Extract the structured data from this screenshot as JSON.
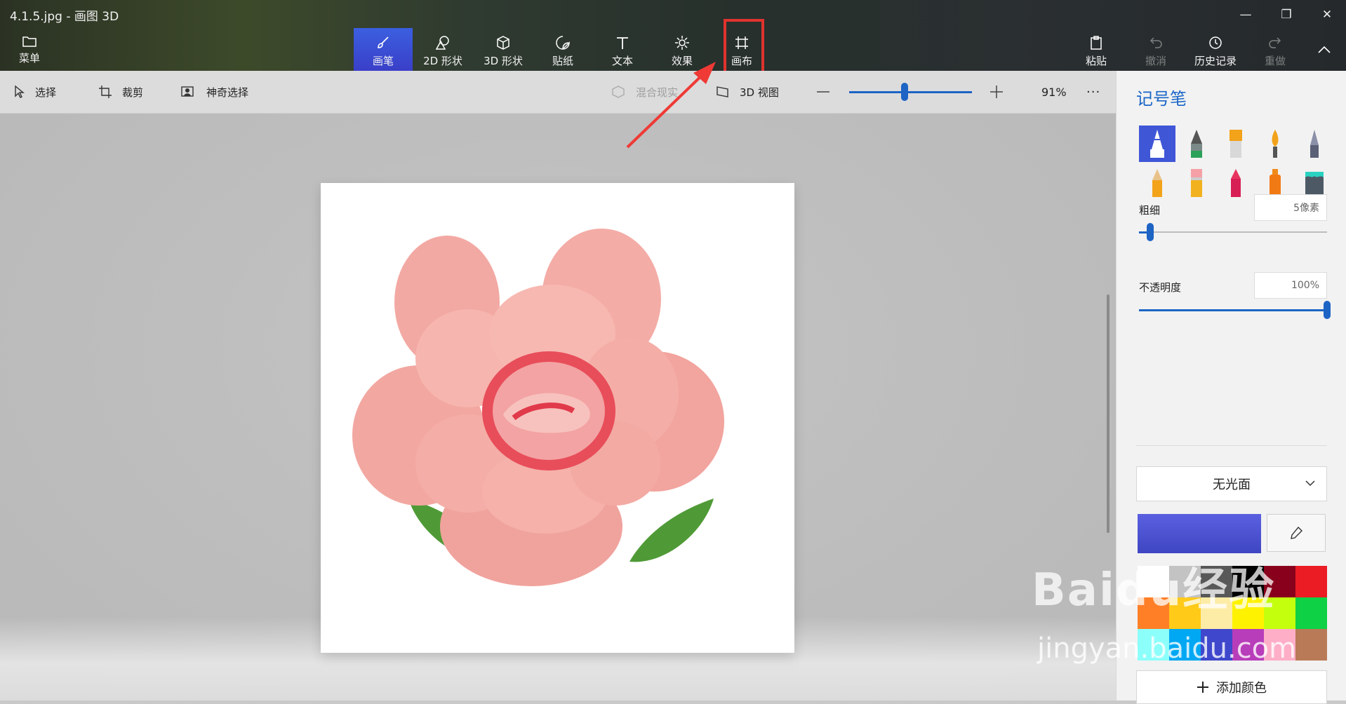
{
  "window": {
    "title": "4.1.5.jpg - 画图 3D",
    "minimize": "—",
    "restore": "❐",
    "close": "✕"
  },
  "toolbar": {
    "menu": "菜单",
    "tools": [
      {
        "label": "画笔",
        "icon": "brush-icon"
      },
      {
        "label": "2D 形状",
        "icon": "2d-shapes-icon"
      },
      {
        "label": "3D 形状",
        "icon": "3d-shapes-icon"
      },
      {
        "label": "贴纸",
        "icon": "sticker-icon"
      },
      {
        "label": "文本",
        "icon": "text-icon"
      },
      {
        "label": "效果",
        "icon": "effects-icon"
      },
      {
        "label": "画布",
        "icon": "canvas-icon"
      }
    ],
    "paste": "粘贴",
    "undo": "撤消",
    "history": "历史记录",
    "redo": "重做"
  },
  "subtoolbar": {
    "select": "选择",
    "crop": "裁剪",
    "magic_select": "神奇选择",
    "mixed_reality": "混合现实",
    "view_3d": "3D 视图",
    "zoom": "91%",
    "zoom_level": 0.45,
    "more": "···"
  },
  "panel": {
    "title": "记号笔",
    "thickness_label": "粗细",
    "thickness_value": "5像素",
    "thickness_level": 0.06,
    "opacity_label": "不透明度",
    "opacity_value": "100%",
    "opacity_level": 1.0,
    "finish": "无光面",
    "add_color": "添加颜色",
    "selected_color": "#3f46c2",
    "palette": [
      "#ffffff",
      "#c3c3c3",
      "#585858",
      "#000000",
      "#88001b",
      "#ec1c24",
      "#ff7f27",
      "#ffca18",
      "#fdeca6",
      "#fff200",
      "#c4ff0e",
      "#0ed145",
      "#8cfffb",
      "#00a8f3",
      "#3f48cc",
      "#b83dba",
      "#ffaec8",
      "#b97a57"
    ]
  },
  "watermark": {
    "logo": "Baidu经验",
    "url": "jingyan.baidu.com"
  }
}
